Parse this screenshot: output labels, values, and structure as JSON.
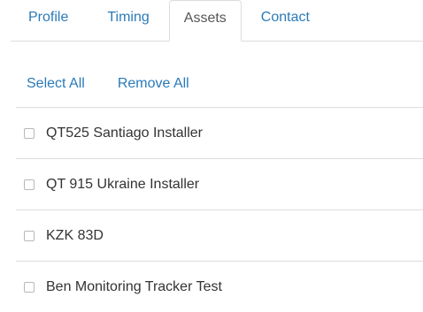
{
  "tabs": [
    {
      "label": "Profile",
      "active": false
    },
    {
      "label": "Timing",
      "active": false
    },
    {
      "label": "Assets",
      "active": true
    },
    {
      "label": "Contact",
      "active": false
    }
  ],
  "actions": {
    "select_all": "Select All",
    "remove_all": "Remove All"
  },
  "assets": [
    {
      "label": "QT525 Santiago Installer",
      "checked": false
    },
    {
      "label": "QT 915 Ukraine Installer",
      "checked": false
    },
    {
      "label": "KZK 83D",
      "checked": false
    },
    {
      "label": "Ben Monitoring Tracker Test",
      "checked": false
    }
  ],
  "colors": {
    "link": "#2a7ab8",
    "text": "#333333",
    "border": "#dddddd"
  }
}
